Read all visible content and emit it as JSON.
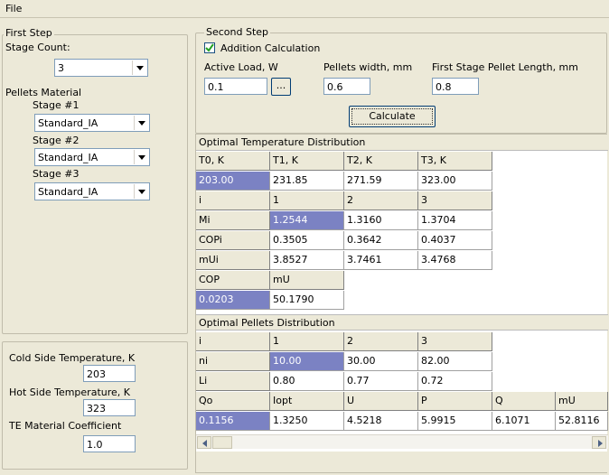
{
  "menu": {
    "file": "File"
  },
  "first_step": {
    "legend": "First Step",
    "stage_count_label": "Stage Count:",
    "stage_count_value": "3",
    "pellets_material_label": "Pellets Material",
    "stages": [
      {
        "label": "Stage #1",
        "value": "Standard_IA"
      },
      {
        "label": "Stage #2",
        "value": "Standard_IA"
      },
      {
        "label": "Stage #3",
        "value": "Standard_IA"
      }
    ]
  },
  "params": {
    "cold_label": "Cold Side Temperature, K",
    "cold_value": "203",
    "hot_label": "Hot Side Temperature, K",
    "hot_value": "323",
    "te_label": "TE Material Coefficient",
    "te_value": "1.0"
  },
  "second_step": {
    "legend": "Second Step",
    "addition_calc_label": "Addition Calculation",
    "addition_calc_checked": true,
    "active_load_label": "Active Load, W",
    "active_load_value": "0.1",
    "browse_label": "...",
    "pellets_width_label": "Pellets width, mm",
    "pellets_width_value": "0.6",
    "first_stage_len_label": "First Stage Pellet Length, mm",
    "first_stage_len_value": "0.8",
    "calculate_label": "Calculate"
  },
  "temp_dist": {
    "title": "Optimal Temperature Distribution",
    "rows": [
      [
        "T0, K",
        "T1, K",
        "T2, K",
        "T3, K"
      ],
      [
        "203.00",
        "231.85",
        "271.59",
        "323.00"
      ],
      [
        "i",
        "1",
        "2",
        "3"
      ],
      [
        "Mi",
        "1.2544",
        "1.3160",
        "1.3704"
      ],
      [
        "COPi",
        "0.3505",
        "0.3642",
        "0.4037"
      ],
      [
        "mUi",
        "3.8527",
        "3.7461",
        "3.4768"
      ],
      [
        "COP",
        "mU"
      ],
      [
        "0.0203",
        "50.1790"
      ]
    ]
  },
  "pellets_dist": {
    "title": "Optimal Pellets Distribution",
    "rows": [
      [
        "i",
        "1",
        "2",
        "3"
      ],
      [
        "ni",
        "10.00",
        "30.00",
        "82.00"
      ],
      [
        "Li",
        "0.80",
        "0.77",
        "0.72"
      ],
      [
        "Qo",
        "Iopt",
        "U",
        "P",
        "Q",
        "mU"
      ],
      [
        "0.1156",
        "1.3250",
        "4.5218",
        "5.9915",
        "6.1071",
        "52.8116"
      ]
    ]
  },
  "colors": {
    "selected": "#7b82c3",
    "window": "#ece9d8"
  }
}
